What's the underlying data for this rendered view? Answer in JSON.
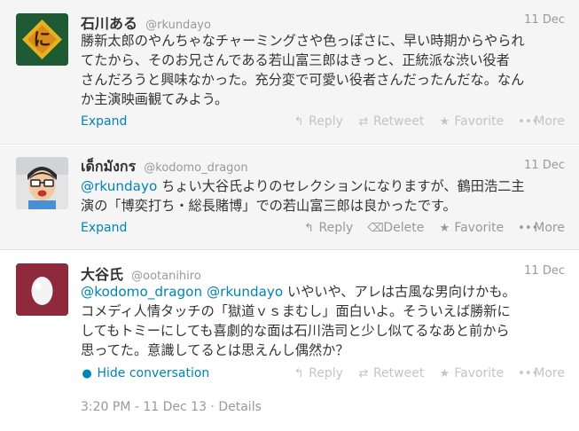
{
  "tweets": [
    {
      "name": "石川ある",
      "handle": "@rkundayo",
      "date": "11 Dec",
      "lines": [
        "勝新太郎のやんちゃなチャーミングさや色っぽさに、早い時期からやられ",
        "てたから、そのお兄さんである若山富三郎はきっと、正統派な渋い役者",
        "さんだろうと興味なかった。充分変で可愛い役者さんだったんだな。なん",
        "か主演映画観てみよう。"
      ],
      "expand": "Expand",
      "actions": [
        "Reply",
        "Retweet",
        "Favorite",
        "More"
      ]
    },
    {
      "name": "เด็กมังกร",
      "handle": "@kodomo_dragon",
      "date": "11 Dec",
      "mention": "@rkundayo",
      "line1_rest": " ちょい大谷氏よりのセレクションになりますが、鶴田浩二主",
      "line2": "演の「博奕打ち・総長賭博」での若山富三郎は良かったです。",
      "expand": "Expand",
      "actions": [
        "Reply",
        "Delete",
        "Favorite",
        "More"
      ]
    },
    {
      "name": "大谷氏",
      "handle": "@ootanihiro",
      "date": "11 Dec",
      "mention1": "@kodomo_dragon",
      "mention2": "@rkundayo",
      "line1_rest": " いやいや、アレは古風な男向けかも。",
      "line2": "コメディ人情タッチの「獄道ｖｓまむし」面白いよ。そういえば勝新に",
      "line3": "してもトミーにしても喜劇的な面は石川浩司と少し似てるなあと前から",
      "line4": "思ってた。意識してるとは思えんし偶然か？",
      "hide": "Hide conversation",
      "actions": [
        "Reply",
        "Retweet",
        "Favorite",
        "More"
      ],
      "timestamp": "3:20 PM - 11 Dec 13",
      "separator": " · ",
      "details": "Details"
    }
  ],
  "colors": {
    "link": "#0084b4",
    "meta": "#999999",
    "text": "#333333",
    "row_bg": "#f5f5f5"
  }
}
